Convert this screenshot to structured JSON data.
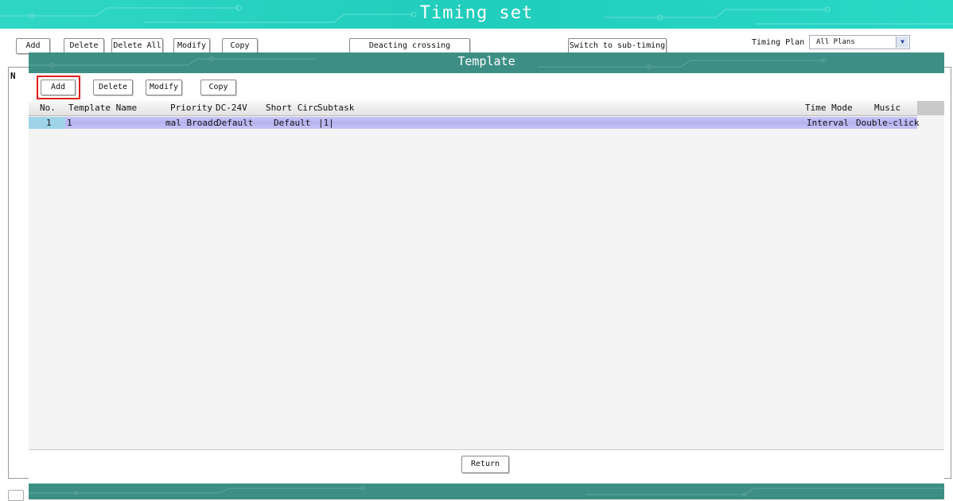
{
  "window": {
    "title": "Timing set",
    "titlebar_color": "#21cdbd"
  },
  "toolbar": {
    "add": "Add",
    "delete": "Delete",
    "delete_all": "Delete All",
    "modify": "Modify",
    "copy": "Copy",
    "deacting_crossing": "Deacting crossing",
    "switch_sub_timing": "Switch to sub-timing",
    "timing_plan_label": "Timing Plan",
    "timing_plan_value": "All Plans",
    "dropdown_icon": "chevron-down-icon"
  },
  "background_list": {
    "first_column": "N"
  },
  "dialog": {
    "title": "Template",
    "titlebar_color": "#3d8f85",
    "toolbar": {
      "add": "Add",
      "delete": "Delete",
      "modify": "Modify",
      "copy": "Copy"
    },
    "columns": [
      "No.",
      "Template Name",
      "Priority",
      "DC-24V",
      "Short Circ",
      "Subtask",
      "Time Mode",
      "Music"
    ],
    "rows": [
      {
        "no": "1",
        "template_name": "1",
        "priority": "mal Broadc",
        "dc24v": "Default",
        "short_circ": "Default",
        "subtask": "|1|",
        "time_mode": "Interval",
        "music": "Double-click"
      }
    ],
    "return": "Return",
    "selected_row_color": "#b6b2f0",
    "highlight_color": "#e01c1c"
  }
}
